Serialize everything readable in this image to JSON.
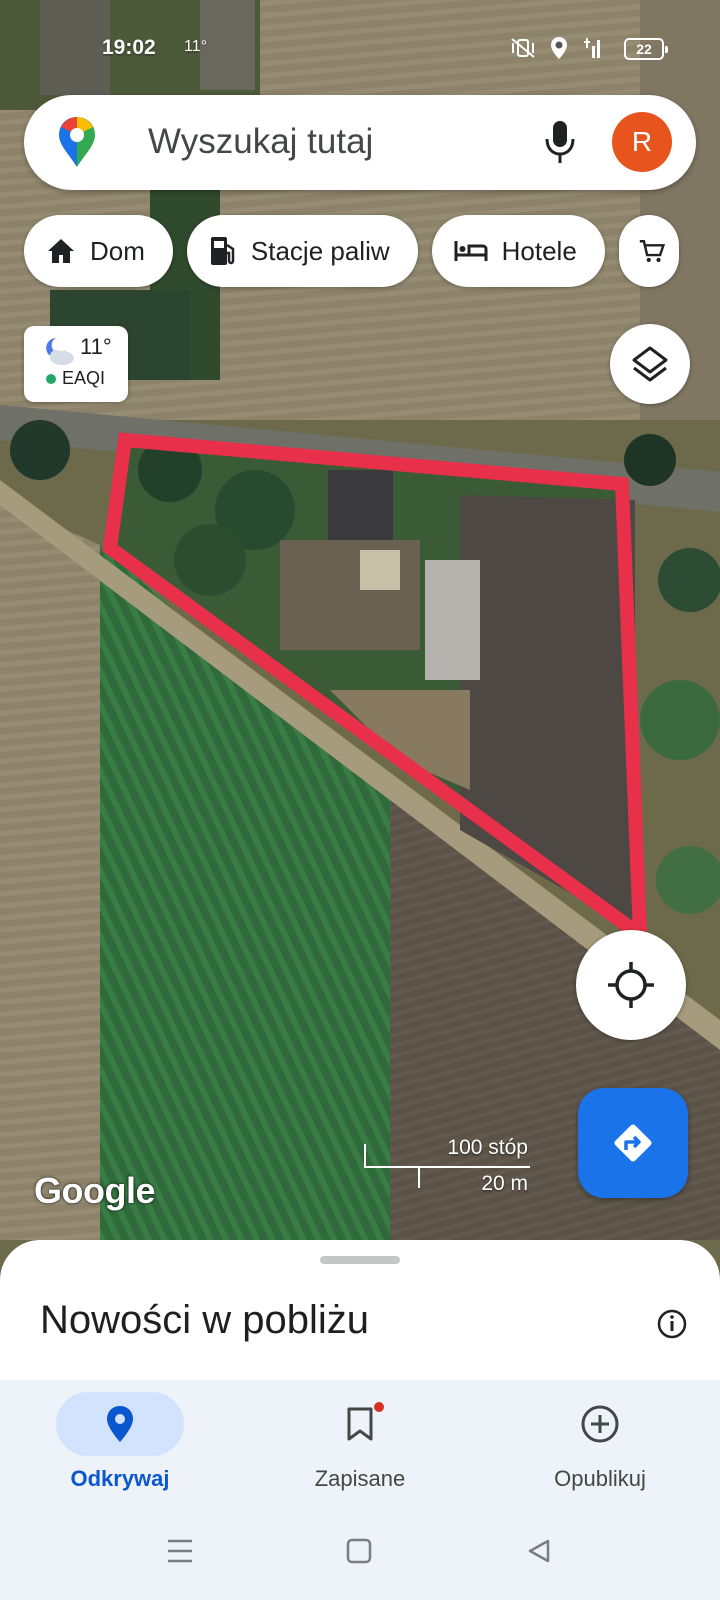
{
  "status_bar": {
    "time": "19:02",
    "temperature": "11°",
    "battery": "22"
  },
  "search": {
    "placeholder": "Wyszukaj tutaj",
    "avatar_letter": "R"
  },
  "chips": [
    {
      "label": "Dom",
      "icon": "home-icon"
    },
    {
      "label": "Stacje paliw",
      "icon": "gas-station-icon"
    },
    {
      "label": "Hotele",
      "icon": "bed-icon"
    },
    {
      "label": "",
      "icon": "shopping-cart-icon"
    }
  ],
  "weather": {
    "temperature": "11°",
    "air_quality": "EAQI"
  },
  "map": {
    "logo": "Google",
    "scale_imperial": "100 stóp",
    "scale_metric": "20 m",
    "annotation_color": "#e8304a"
  },
  "sheet": {
    "title": "Nowości w pobliżu"
  },
  "bottom_nav": {
    "items": [
      {
        "label": "Odkrywaj",
        "icon": "location-pin-icon",
        "active": true
      },
      {
        "label": "Zapisane",
        "icon": "bookmark-icon",
        "active": false
      },
      {
        "label": "Opublikuj",
        "icon": "add-circle-icon",
        "active": false
      }
    ]
  },
  "colors": {
    "accent": "#1a73e8",
    "avatar": "#e8541e",
    "active_pill": "#d3e3fd"
  }
}
